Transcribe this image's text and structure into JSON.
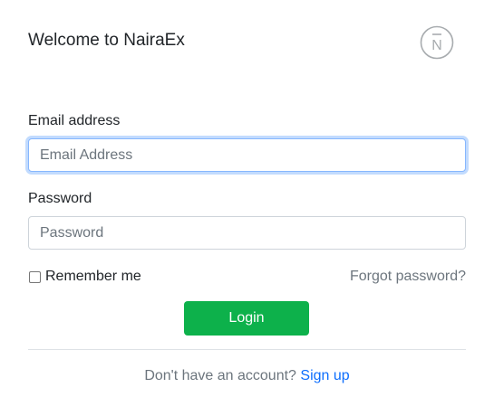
{
  "header": {
    "title": "Welcome to NairaEx",
    "logo_icon": "nairaex-logo-icon",
    "logo_letter": "N"
  },
  "form": {
    "email_label": "Email address",
    "email_placeholder": "Email Address",
    "email_value": "",
    "password_label": "Password",
    "password_placeholder": "Password",
    "password_value": "",
    "remember_label": "Remember me",
    "remember_checked": false,
    "forgot_label": "Forgot password?",
    "login_label": "Login"
  },
  "footer": {
    "prompt": "Don't have an account?",
    "signup_label": "Sign up"
  },
  "colors": {
    "primary_button": "#0db14b",
    "link": "#0d6efd",
    "muted_text": "#6c757d",
    "focus_border": "#86b7fe"
  }
}
